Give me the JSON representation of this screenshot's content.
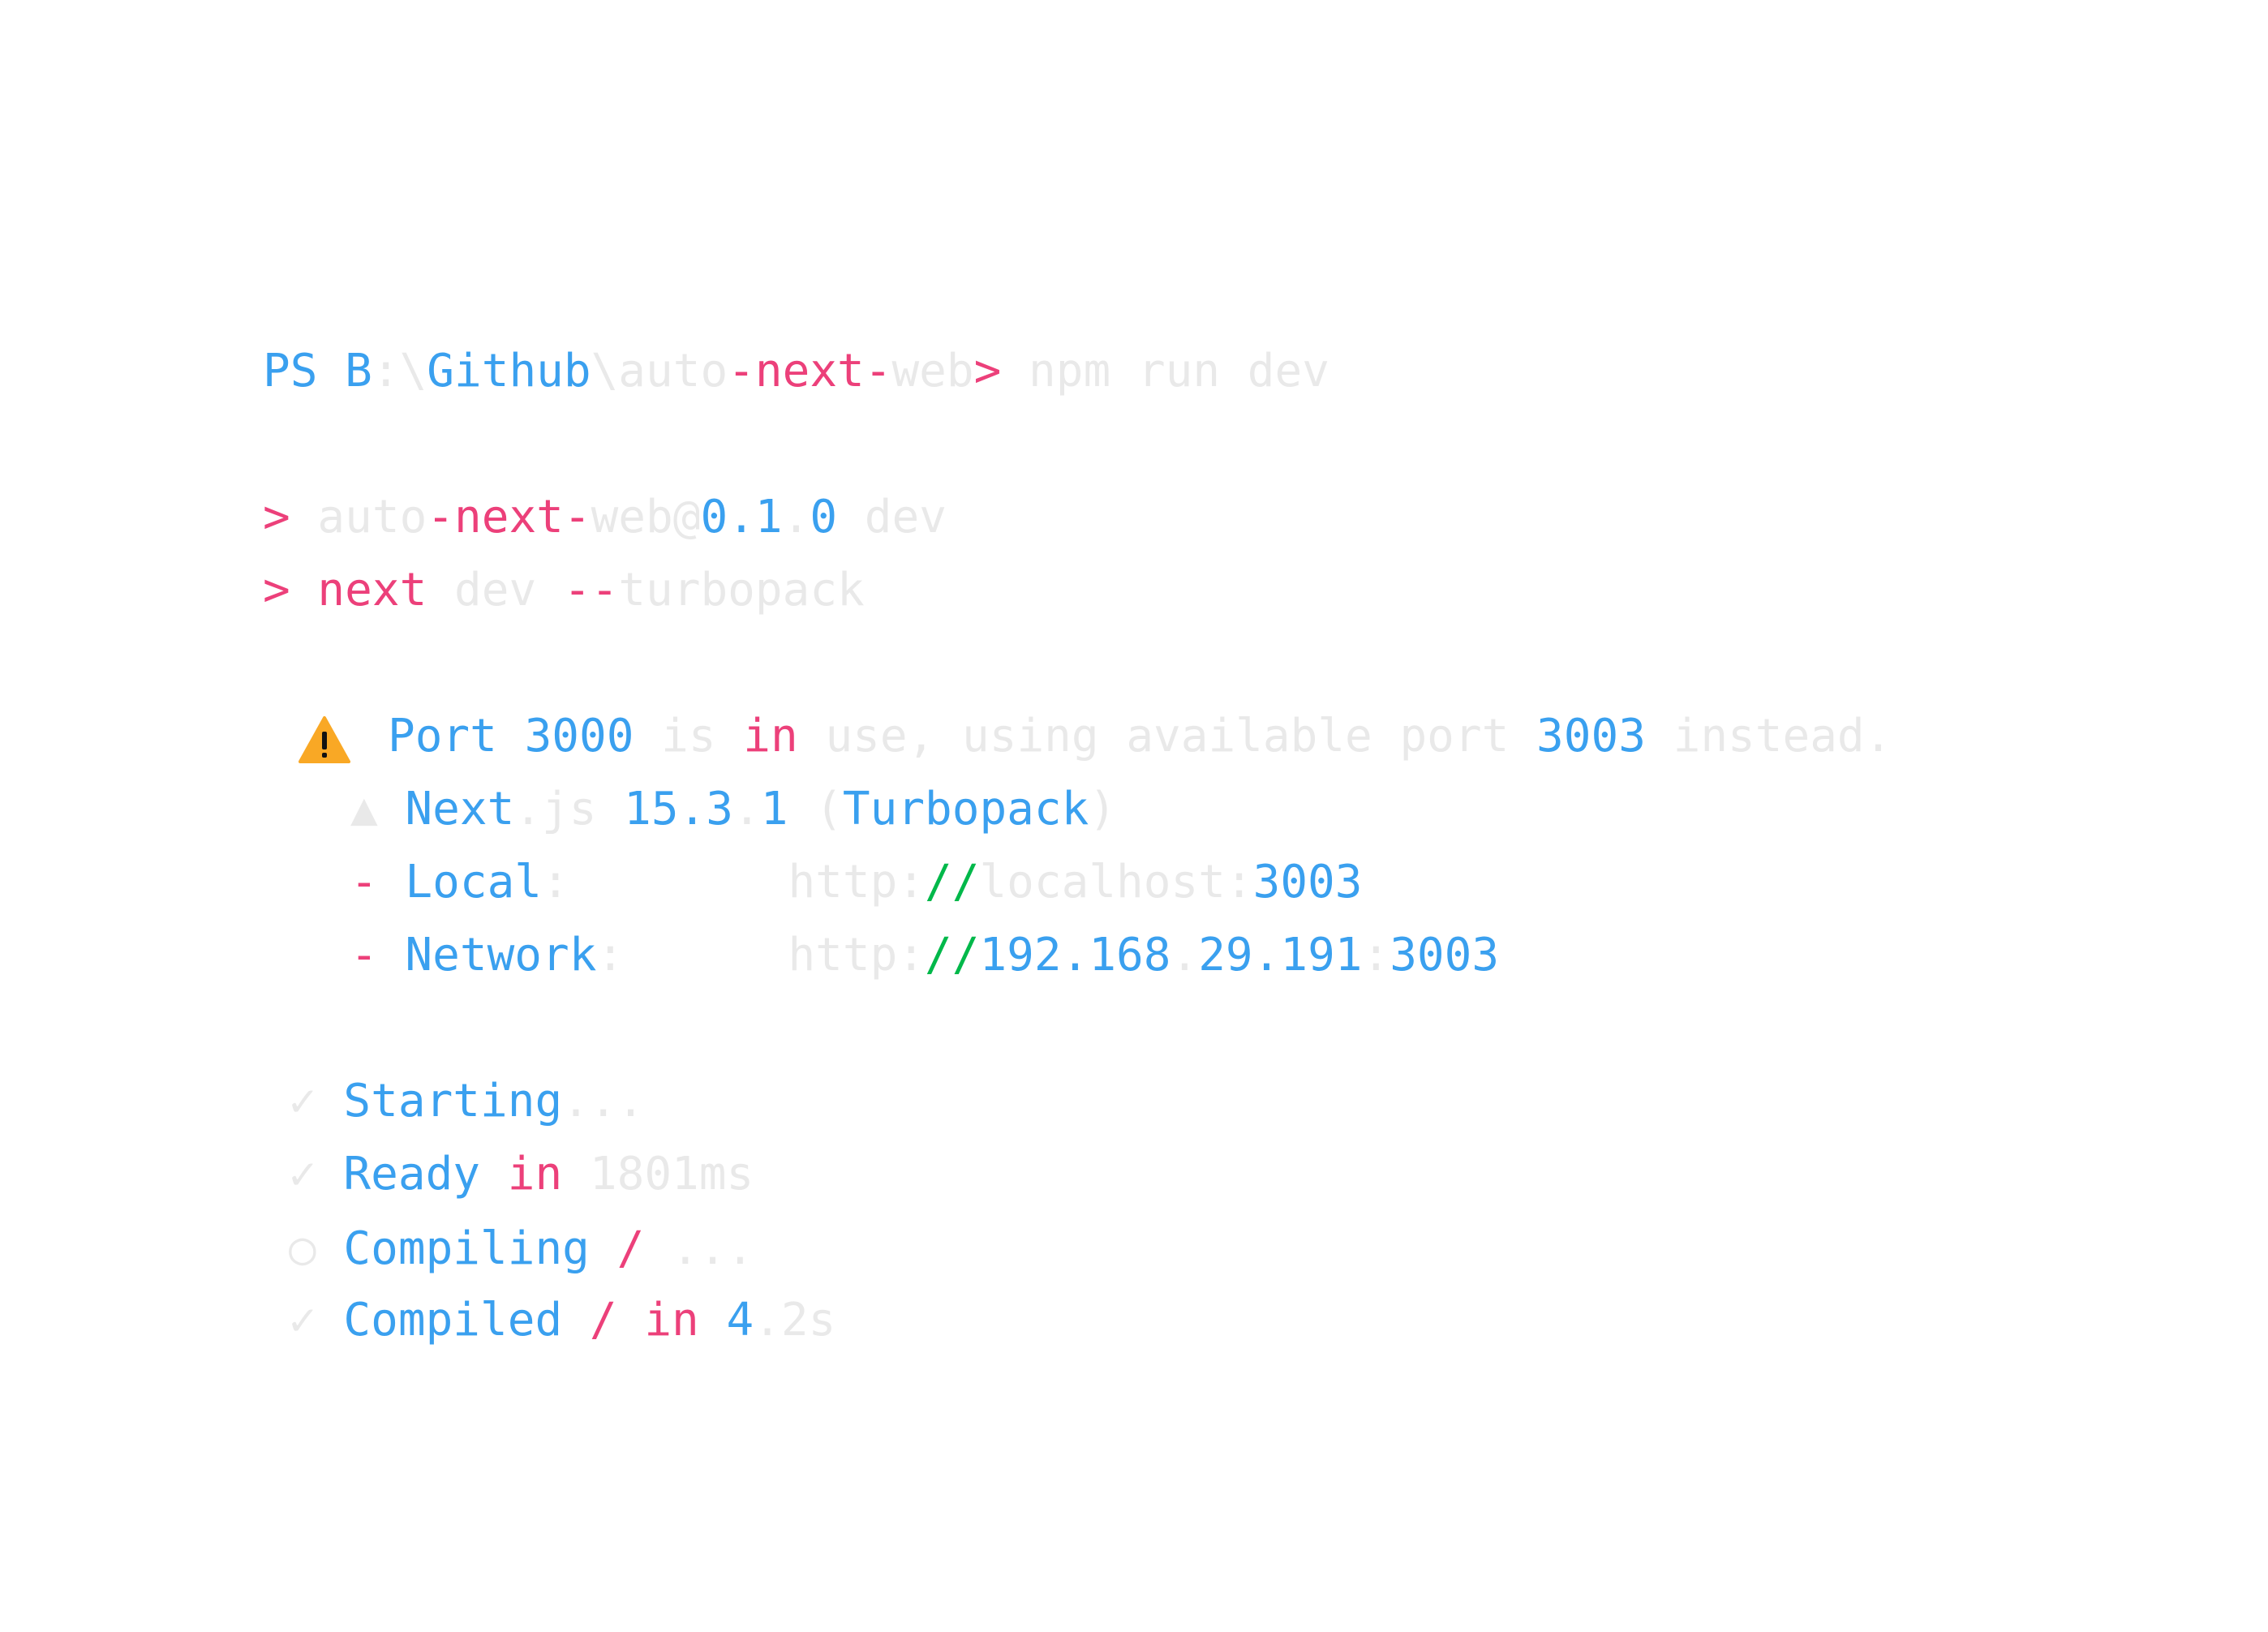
{
  "terminal": {
    "accent_colors": {
      "blue": "#3aa0ef",
      "pink": "#ec407a",
      "green": "#00b84a",
      "faint": "#e9e9e9",
      "warning": "#f9a825"
    },
    "prompt_line": {
      "segments": [
        {
          "text": "PS B",
          "color": "blue"
        },
        {
          "text": ":\\",
          "color": "faint"
        },
        {
          "text": "Github",
          "color": "blue"
        },
        {
          "text": "\\auto",
          "color": "faint"
        },
        {
          "text": "-next-",
          "color": "pink"
        },
        {
          "text": "web",
          "color": "faint"
        },
        {
          "text": ">",
          "color": "pink"
        },
        {
          "text": " npm run dev",
          "color": "faint"
        }
      ]
    },
    "script_line_1": {
      "segments": [
        {
          "text": ">",
          "color": "pink"
        },
        {
          "text": " auto",
          "color": "faint"
        },
        {
          "text": "-next-",
          "color": "pink"
        },
        {
          "text": "web@",
          "color": "faint"
        },
        {
          "text": "0.1",
          "color": "blue"
        },
        {
          "text": ".",
          "color": "faint"
        },
        {
          "text": "0",
          "color": "blue"
        },
        {
          "text": " dev",
          "color": "faint"
        }
      ]
    },
    "script_line_2": {
      "segments": [
        {
          "text": ">",
          "color": "pink"
        },
        {
          "text": " next",
          "color": "pink"
        },
        {
          "text": " dev ",
          "color": "faint"
        },
        {
          "text": "--",
          "color": "pink"
        },
        {
          "text": "turbopack",
          "color": "faint"
        }
      ]
    },
    "warning_line": {
      "icon": "warning-icon",
      "segments": [
        {
          "text": "Port ",
          "color": "blue"
        },
        {
          "text": "3000",
          "color": "blue"
        },
        {
          "text": " is ",
          "color": "faint"
        },
        {
          "text": "in",
          "color": "pink"
        },
        {
          "text": " use, using available port ",
          "color": "faint"
        },
        {
          "text": "3003",
          "color": "blue"
        },
        {
          "text": " instead.",
          "color": "faint"
        }
      ]
    },
    "next_line": {
      "icon": "triangle-icon",
      "segments": [
        {
          "text": "▲",
          "color": "faint"
        },
        {
          "text": " Next",
          "color": "blue"
        },
        {
          "text": ".js ",
          "color": "faint"
        },
        {
          "text": "15.3",
          "color": "blue"
        },
        {
          "text": ".",
          "color": "faint"
        },
        {
          "text": "1",
          "color": "blue"
        },
        {
          "text": " (",
          "color": "faint"
        },
        {
          "text": "Turbopack",
          "color": "blue"
        },
        {
          "text": ")",
          "color": "faint"
        }
      ]
    },
    "local_line": {
      "segments": [
        {
          "text": "-",
          "color": "pink"
        },
        {
          "text": " Local",
          "color": "blue"
        },
        {
          "text": ":        ",
          "color": "faint"
        },
        {
          "text": "http:",
          "color": "faint"
        },
        {
          "text": "//",
          "color": "green"
        },
        {
          "text": "localhost:",
          "color": "faint"
        },
        {
          "text": "3003",
          "color": "blue"
        }
      ]
    },
    "network_line": {
      "segments": [
        {
          "text": "-",
          "color": "pink"
        },
        {
          "text": " Network",
          "color": "blue"
        },
        {
          "text": ":      ",
          "color": "faint"
        },
        {
          "text": "http:",
          "color": "faint"
        },
        {
          "text": "//",
          "color": "green"
        },
        {
          "text": "192.168",
          "color": "blue"
        },
        {
          "text": ".",
          "color": "faint"
        },
        {
          "text": "29.191",
          "color": "blue"
        },
        {
          "text": ":",
          "color": "faint"
        },
        {
          "text": "3003",
          "color": "blue"
        }
      ]
    },
    "starting_line": {
      "segments": [
        {
          "text": "✓",
          "color": "faint"
        },
        {
          "text": " Starting",
          "color": "blue"
        },
        {
          "text": "...",
          "color": "faint"
        }
      ]
    },
    "ready_line": {
      "segments": [
        {
          "text": "✓",
          "color": "faint"
        },
        {
          "text": " Ready ",
          "color": "blue"
        },
        {
          "text": "in",
          "color": "pink"
        },
        {
          "text": " 1801ms",
          "color": "faint"
        }
      ]
    },
    "compiling_line": {
      "segments": [
        {
          "text": "○",
          "color": "faint"
        },
        {
          "text": " Compiling ",
          "color": "blue"
        },
        {
          "text": "/",
          "color": "pink"
        },
        {
          "text": " ...",
          "color": "faint"
        }
      ]
    },
    "compiled_line": {
      "segments": [
        {
          "text": "✓",
          "color": "faint"
        },
        {
          "text": " Compiled ",
          "color": "blue"
        },
        {
          "text": "/",
          "color": "pink"
        },
        {
          "text": " ",
          "color": "faint"
        },
        {
          "text": "in",
          "color": "pink"
        },
        {
          "text": " 4",
          "color": "blue"
        },
        {
          "text": ".2s",
          "color": "faint"
        }
      ]
    }
  }
}
